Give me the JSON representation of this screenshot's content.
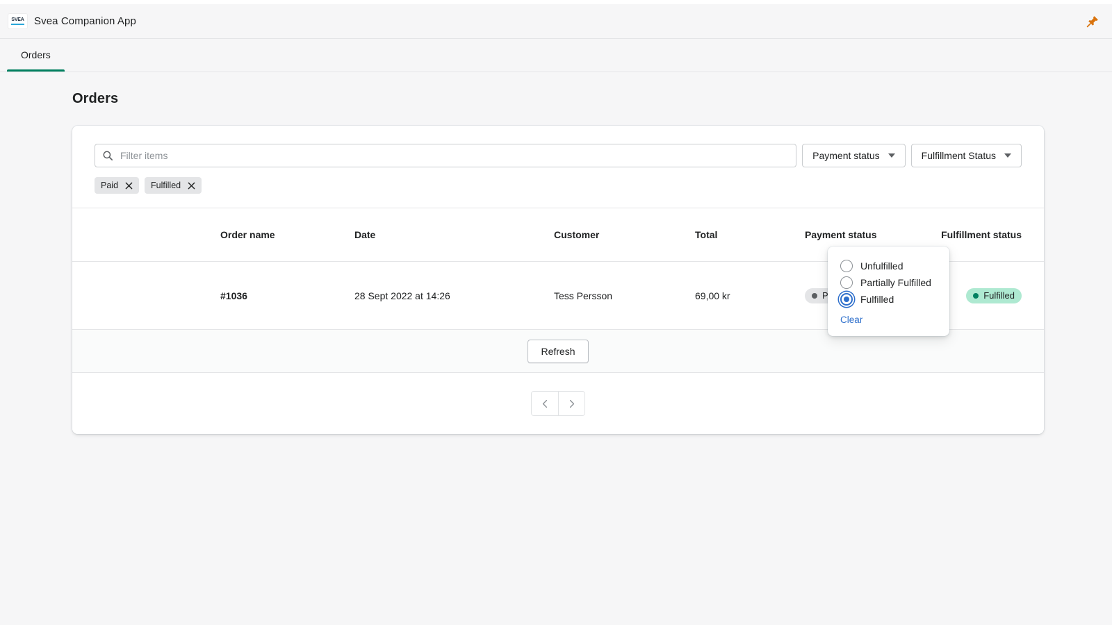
{
  "app": {
    "title": "Svea Companion App",
    "logo_wordmark": "SVEA",
    "pin_icon": "pushpin-icon",
    "accent_green": "#007f5f",
    "accent_blue": "#2c6ecb"
  },
  "tabs": [
    {
      "label": "Orders",
      "active": true
    }
  ],
  "page": {
    "title": "Orders"
  },
  "filters": {
    "search": {
      "icon": "search-icon",
      "value": "",
      "placeholder": "Filter items"
    },
    "payment_status_button": {
      "label": "Payment status",
      "icon": "chevron-down-icon"
    },
    "fulfillment_status_button": {
      "label": "Fulfillment Status",
      "icon": "chevron-down-icon"
    },
    "chips": [
      {
        "label": "Paid",
        "remove_icon": "close-icon"
      },
      {
        "label": "Fulfilled",
        "remove_icon": "close-icon"
      }
    ]
  },
  "fulfillment_dropdown": {
    "open": true,
    "options": [
      {
        "label": "Unfulfilled",
        "selected": false
      },
      {
        "label": "Partially Fulfilled",
        "selected": false
      },
      {
        "label": "Fulfilled",
        "selected": true
      }
    ],
    "clear_label": "Clear"
  },
  "table": {
    "columns": [
      "Order name",
      "Date",
      "Customer",
      "Total",
      "Payment status",
      "Fulfillment status"
    ],
    "rows": [
      {
        "order_name": "#1036",
        "date": "28 Sept 2022 at 14:26",
        "customer": "Tess Persson",
        "total": "69,00 kr",
        "payment_status": "Paid",
        "fulfillment_status": "Fulfilled"
      }
    ]
  },
  "footer": {
    "refresh_label": "Refresh",
    "pagination": {
      "prev_icon": "chevron-left-icon",
      "next_icon": "chevron-right-icon"
    }
  }
}
